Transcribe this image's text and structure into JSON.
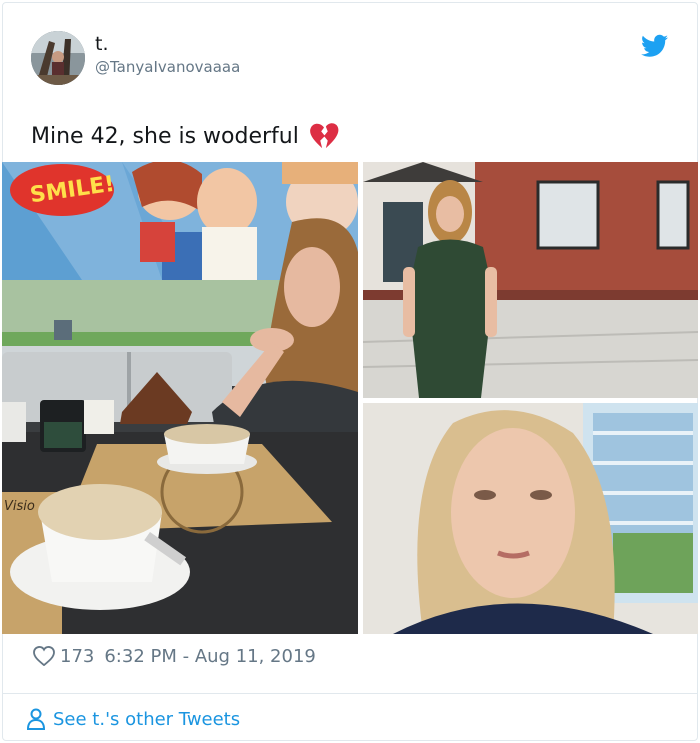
{
  "user": {
    "display_name": "t.",
    "handle": "@TanyaIvanovaaaa"
  },
  "tweet": {
    "text": "Mine 42, she is woderful",
    "emoji": "broken-heart-emoji",
    "likes": "173",
    "timestamp": "6:32 PM - Aug 11, 2019"
  },
  "footer": {
    "see_more": "See t.'s other Tweets"
  },
  "icons": {
    "bird": "twitter-bird-icon",
    "like": "heart-outline-icon",
    "person": "person-outline-icon"
  },
  "colors": {
    "twitter_blue": "#1da1f2",
    "link_blue": "#1b95e0",
    "muted_text": "#657786",
    "emoji_red": "#dd2e44"
  }
}
